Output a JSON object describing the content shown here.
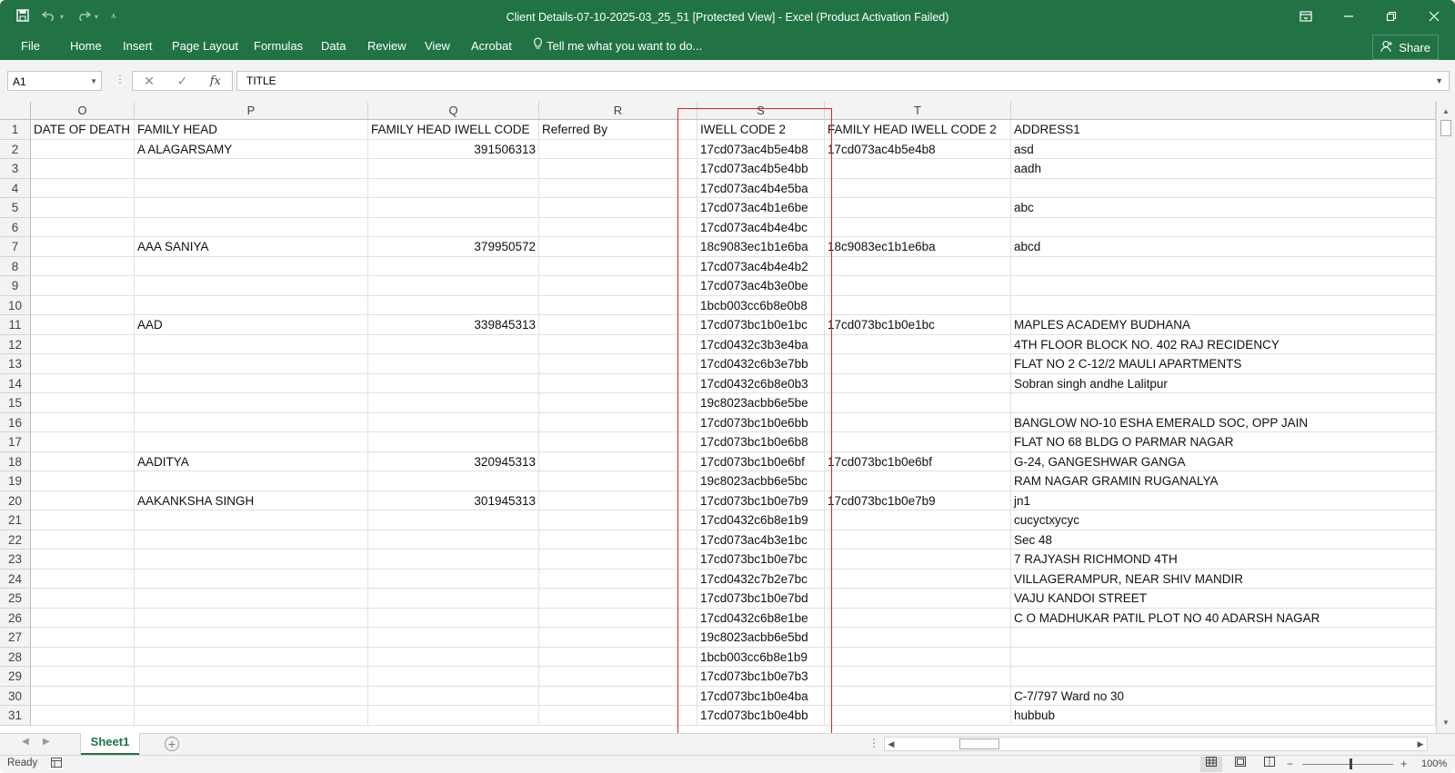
{
  "titlebar": {
    "title": "Client Details-07-10-2025-03_25_51  [Protected View]  -  Excel (Product Activation Failed)",
    "qat_icons": [
      "save-icon",
      "undo-icon",
      "redo-icon",
      "customize-qat-icon"
    ],
    "accent": "#217346"
  },
  "ribbon": {
    "tabs": [
      "File",
      "Home",
      "Insert",
      "Page Layout",
      "Formulas",
      "Data",
      "Review",
      "View",
      "Acrobat"
    ],
    "tell_me": "Tell me what you want to do...",
    "share": "Share"
  },
  "formula_bar": {
    "name_box": "A1",
    "formula": "TITLE"
  },
  "sheet": {
    "columns": [
      "O",
      "P",
      "Q",
      "R",
      "S",
      "T",
      ""
    ],
    "rows": [
      {
        "n": "1",
        "cells": [
          "DATE OF DEATH",
          "FAMILY HEAD",
          "FAMILY HEAD IWELL CODE",
          "Referred By",
          "IWELL CODE 2",
          "FAMILY HEAD IWELL CODE 2",
          "ADDRESS1"
        ]
      },
      {
        "n": "2",
        "cells": [
          "",
          "A ALAGARSAMY",
          "391506313",
          "",
          "17cd073ac4b5e4b8",
          "17cd073ac4b5e4b8",
          "asd"
        ]
      },
      {
        "n": "3",
        "cells": [
          "",
          "",
          "",
          "",
          "17cd073ac4b5e4bb",
          "",
          "aadh"
        ]
      },
      {
        "n": "4",
        "cells": [
          "",
          "",
          "",
          "",
          "17cd073ac4b4e5ba",
          "",
          ""
        ]
      },
      {
        "n": "5",
        "cells": [
          "",
          "",
          "",
          "",
          "17cd073ac4b1e6be",
          "",
          "abc"
        ]
      },
      {
        "n": "6",
        "cells": [
          "",
          "",
          "",
          "",
          "17cd073ac4b4e4bc",
          "",
          ""
        ]
      },
      {
        "n": "7",
        "cells": [
          "",
          "AAA SANIYA",
          "379950572",
          "",
          "18c9083ec1b1e6ba",
          "18c9083ec1b1e6ba",
          "abcd"
        ]
      },
      {
        "n": "8",
        "cells": [
          "",
          "",
          "",
          "",
          "17cd073ac4b4e4b2",
          "",
          ""
        ]
      },
      {
        "n": "9",
        "cells": [
          "",
          "",
          "",
          "",
          "17cd073ac4b3e0be",
          "",
          ""
        ]
      },
      {
        "n": "10",
        "cells": [
          "",
          "",
          "",
          "",
          "1bcb003cc6b8e0b8",
          "",
          ""
        ]
      },
      {
        "n": "11",
        "cells": [
          "",
          "AAD",
          "339845313",
          "",
          "17cd073bc1b0e1bc",
          "17cd073bc1b0e1bc",
          "MAPLES ACADEMY BUDHANA"
        ]
      },
      {
        "n": "12",
        "cells": [
          "",
          "",
          "",
          "",
          "17cd0432c3b3e4ba",
          "",
          "4TH FLOOR BLOCK NO. 402 RAJ RECIDENCY"
        ]
      },
      {
        "n": "13",
        "cells": [
          "",
          "",
          "",
          "",
          "17cd0432c6b3e7bb",
          "",
          "FLAT NO 2 C-12/2 MAULI APARTMENTS"
        ]
      },
      {
        "n": "14",
        "cells": [
          "",
          "",
          "",
          "",
          "17cd0432c6b8e0b3",
          "",
          "Sobran singh andhe Lalitpur"
        ]
      },
      {
        "n": "15",
        "cells": [
          "",
          "",
          "",
          "",
          "19c8023acbb6e5be",
          "",
          ""
        ]
      },
      {
        "n": "16",
        "cells": [
          "",
          "",
          "",
          "",
          "17cd073bc1b0e6bb",
          "",
          "BANGLOW NO-10 ESHA EMERALD SOC, OPP JAIN"
        ]
      },
      {
        "n": "17",
        "cells": [
          "",
          "",
          "",
          "",
          "17cd073bc1b0e6b8",
          "",
          "FLAT NO 68 BLDG O PARMAR NAGAR"
        ]
      },
      {
        "n": "18",
        "cells": [
          "",
          "AADITYA",
          "320945313",
          "",
          "17cd073bc1b0e6bf",
          "17cd073bc1b0e6bf",
          "G-24, GANGESHWAR GANGA"
        ]
      },
      {
        "n": "19",
        "cells": [
          "",
          "",
          "",
          "",
          "19c8023acbb6e5bc",
          "",
          "RAM NAGAR GRAMIN RUGANALYA"
        ]
      },
      {
        "n": "20",
        "cells": [
          "",
          "AAKANKSHA SINGH",
          "301945313",
          "",
          "17cd073bc1b0e7b9",
          "17cd073bc1b0e7b9",
          "jn1"
        ]
      },
      {
        "n": "21",
        "cells": [
          "",
          "",
          "",
          "",
          "17cd0432c6b8e1b9",
          "",
          "cucyctxycyc"
        ]
      },
      {
        "n": "22",
        "cells": [
          "",
          "",
          "",
          "",
          "17cd073ac4b3e1bc",
          "",
          "Sec 48"
        ]
      },
      {
        "n": "23",
        "cells": [
          "",
          "",
          "",
          "",
          "17cd073bc1b0e7bc",
          "",
          "7 RAJYASH RICHMOND 4TH"
        ]
      },
      {
        "n": "24",
        "cells": [
          "",
          "",
          "",
          "",
          "17cd0432c7b2e7bc",
          "",
          "VILLAGERAMPUR, NEAR SHIV MANDIR"
        ]
      },
      {
        "n": "25",
        "cells": [
          "",
          "",
          "",
          "",
          "17cd073bc1b0e7bd",
          "",
          "VAJU KANDOI STREET"
        ]
      },
      {
        "n": "26",
        "cells": [
          "",
          "",
          "",
          "",
          "17cd0432c6b8e1be",
          "",
          "C O MADHUKAR PATIL PLOT NO 40 ADARSH NAGAR"
        ]
      },
      {
        "n": "27",
        "cells": [
          "",
          "",
          "",
          "",
          "19c8023acbb6e5bd",
          "",
          ""
        ]
      },
      {
        "n": "28",
        "cells": [
          "",
          "",
          "",
          "",
          "1bcb003cc6b8e1b9",
          "",
          ""
        ]
      },
      {
        "n": "29",
        "cells": [
          "",
          "",
          "",
          "",
          "17cd073bc1b0e7b3",
          "",
          ""
        ]
      },
      {
        "n": "30",
        "cells": [
          "",
          "",
          "",
          "",
          "17cd073bc1b0e4ba",
          "",
          "C-7/797 Ward no 30"
        ]
      },
      {
        "n": "31",
        "cells": [
          "",
          "",
          "",
          "",
          "17cd073bc1b0e4bb",
          "",
          "hubbub"
        ]
      }
    ],
    "highlight_color": "#e02424"
  },
  "sheet_tabs": {
    "active": "Sheet1"
  },
  "statusbar": {
    "ready": "Ready",
    "zoom": "100%"
  }
}
